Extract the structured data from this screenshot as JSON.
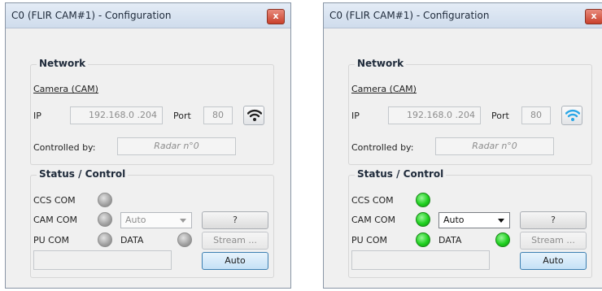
{
  "windows": [
    {
      "title": "C0 (FLIR CAM#1) - Configuration",
      "close_label": "x",
      "network": {
        "heading": "Network",
        "camera_link": "Camera (CAM)",
        "ip_label": "IP",
        "ip_value": "192.168.0 .204",
        "port_label": "Port",
        "port_value": "80",
        "wifi_icon": "wifi-icon",
        "wifi_color": "#222222",
        "controlled_by_label": "Controlled by:",
        "controlled_by_value": "Radar n°0"
      },
      "status": {
        "heading": "Status / Control",
        "ccs_com_label": "CCS COM",
        "ccs_com_state": "off",
        "cam_com_label": "CAM COM",
        "cam_com_state": "off",
        "mode_select": "Auto",
        "help_button": "?",
        "pu_com_label": "PU COM",
        "pu_com_state": "off",
        "data_label": "DATA",
        "data_state": "off",
        "stream_button": "Stream ...",
        "message": "",
        "auto_button": "Auto"
      }
    },
    {
      "title": "C0 (FLIR CAM#1) - Configuration",
      "close_label": "x",
      "network": {
        "heading": "Network",
        "camera_link": "Camera (CAM)",
        "ip_label": "IP",
        "ip_value": "192.168.0 .204",
        "port_label": "Port",
        "port_value": "80",
        "wifi_icon": "wifi-icon",
        "wifi_color": "#2aa6e6",
        "controlled_by_label": "Controlled by:",
        "controlled_by_value": "Radar n°0"
      },
      "status": {
        "heading": "Status / Control",
        "ccs_com_label": "CCS COM",
        "ccs_com_state": "on",
        "cam_com_label": "CAM COM",
        "cam_com_state": "on",
        "mode_select": "Auto",
        "help_button": "?",
        "pu_com_label": "PU COM",
        "pu_com_state": "on",
        "data_label": "DATA",
        "data_state": "on",
        "stream_button": "Stream ...",
        "message": "",
        "auto_button": "Auto"
      }
    }
  ],
  "colors": {
    "led_on": "#1fd01f",
    "led_off": "#a0a0a0",
    "active_button_border": "#3c7fb1"
  }
}
